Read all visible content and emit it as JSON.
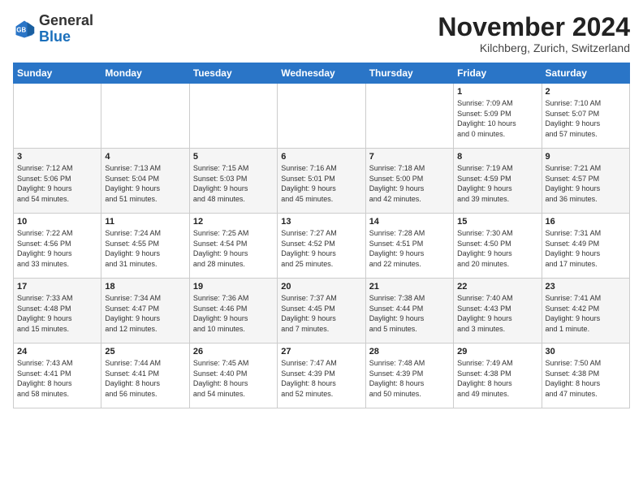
{
  "header": {
    "logo_general": "General",
    "logo_blue": "Blue",
    "month_title": "November 2024",
    "location": "Kilchberg, Zurich, Switzerland"
  },
  "weekdays": [
    "Sunday",
    "Monday",
    "Tuesday",
    "Wednesday",
    "Thursday",
    "Friday",
    "Saturday"
  ],
  "rows": [
    [
      {
        "day": "",
        "info": ""
      },
      {
        "day": "",
        "info": ""
      },
      {
        "day": "",
        "info": ""
      },
      {
        "day": "",
        "info": ""
      },
      {
        "day": "",
        "info": ""
      },
      {
        "day": "1",
        "info": "Sunrise: 7:09 AM\nSunset: 5:09 PM\nDaylight: 10 hours\nand 0 minutes."
      },
      {
        "day": "2",
        "info": "Sunrise: 7:10 AM\nSunset: 5:07 PM\nDaylight: 9 hours\nand 57 minutes."
      }
    ],
    [
      {
        "day": "3",
        "info": "Sunrise: 7:12 AM\nSunset: 5:06 PM\nDaylight: 9 hours\nand 54 minutes."
      },
      {
        "day": "4",
        "info": "Sunrise: 7:13 AM\nSunset: 5:04 PM\nDaylight: 9 hours\nand 51 minutes."
      },
      {
        "day": "5",
        "info": "Sunrise: 7:15 AM\nSunset: 5:03 PM\nDaylight: 9 hours\nand 48 minutes."
      },
      {
        "day": "6",
        "info": "Sunrise: 7:16 AM\nSunset: 5:01 PM\nDaylight: 9 hours\nand 45 minutes."
      },
      {
        "day": "7",
        "info": "Sunrise: 7:18 AM\nSunset: 5:00 PM\nDaylight: 9 hours\nand 42 minutes."
      },
      {
        "day": "8",
        "info": "Sunrise: 7:19 AM\nSunset: 4:59 PM\nDaylight: 9 hours\nand 39 minutes."
      },
      {
        "day": "9",
        "info": "Sunrise: 7:21 AM\nSunset: 4:57 PM\nDaylight: 9 hours\nand 36 minutes."
      }
    ],
    [
      {
        "day": "10",
        "info": "Sunrise: 7:22 AM\nSunset: 4:56 PM\nDaylight: 9 hours\nand 33 minutes."
      },
      {
        "day": "11",
        "info": "Sunrise: 7:24 AM\nSunset: 4:55 PM\nDaylight: 9 hours\nand 31 minutes."
      },
      {
        "day": "12",
        "info": "Sunrise: 7:25 AM\nSunset: 4:54 PM\nDaylight: 9 hours\nand 28 minutes."
      },
      {
        "day": "13",
        "info": "Sunrise: 7:27 AM\nSunset: 4:52 PM\nDaylight: 9 hours\nand 25 minutes."
      },
      {
        "day": "14",
        "info": "Sunrise: 7:28 AM\nSunset: 4:51 PM\nDaylight: 9 hours\nand 22 minutes."
      },
      {
        "day": "15",
        "info": "Sunrise: 7:30 AM\nSunset: 4:50 PM\nDaylight: 9 hours\nand 20 minutes."
      },
      {
        "day": "16",
        "info": "Sunrise: 7:31 AM\nSunset: 4:49 PM\nDaylight: 9 hours\nand 17 minutes."
      }
    ],
    [
      {
        "day": "17",
        "info": "Sunrise: 7:33 AM\nSunset: 4:48 PM\nDaylight: 9 hours\nand 15 minutes."
      },
      {
        "day": "18",
        "info": "Sunrise: 7:34 AM\nSunset: 4:47 PM\nDaylight: 9 hours\nand 12 minutes."
      },
      {
        "day": "19",
        "info": "Sunrise: 7:36 AM\nSunset: 4:46 PM\nDaylight: 9 hours\nand 10 minutes."
      },
      {
        "day": "20",
        "info": "Sunrise: 7:37 AM\nSunset: 4:45 PM\nDaylight: 9 hours\nand 7 minutes."
      },
      {
        "day": "21",
        "info": "Sunrise: 7:38 AM\nSunset: 4:44 PM\nDaylight: 9 hours\nand 5 minutes."
      },
      {
        "day": "22",
        "info": "Sunrise: 7:40 AM\nSunset: 4:43 PM\nDaylight: 9 hours\nand 3 minutes."
      },
      {
        "day": "23",
        "info": "Sunrise: 7:41 AM\nSunset: 4:42 PM\nDaylight: 9 hours\nand 1 minute."
      }
    ],
    [
      {
        "day": "24",
        "info": "Sunrise: 7:43 AM\nSunset: 4:41 PM\nDaylight: 8 hours\nand 58 minutes."
      },
      {
        "day": "25",
        "info": "Sunrise: 7:44 AM\nSunset: 4:41 PM\nDaylight: 8 hours\nand 56 minutes."
      },
      {
        "day": "26",
        "info": "Sunrise: 7:45 AM\nSunset: 4:40 PM\nDaylight: 8 hours\nand 54 minutes."
      },
      {
        "day": "27",
        "info": "Sunrise: 7:47 AM\nSunset: 4:39 PM\nDaylight: 8 hours\nand 52 minutes."
      },
      {
        "day": "28",
        "info": "Sunrise: 7:48 AM\nSunset: 4:39 PM\nDaylight: 8 hours\nand 50 minutes."
      },
      {
        "day": "29",
        "info": "Sunrise: 7:49 AM\nSunset: 4:38 PM\nDaylight: 8 hours\nand 49 minutes."
      },
      {
        "day": "30",
        "info": "Sunrise: 7:50 AM\nSunset: 4:38 PM\nDaylight: 8 hours\nand 47 minutes."
      }
    ]
  ]
}
